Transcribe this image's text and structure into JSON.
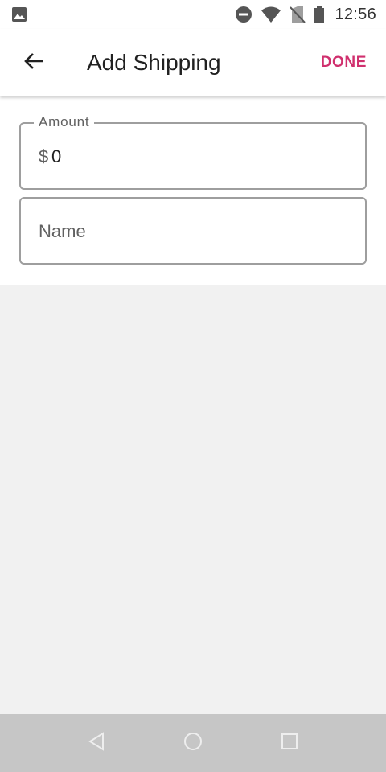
{
  "status_bar": {
    "time": "12:56",
    "icons": [
      "image-icon",
      "do-not-disturb-icon",
      "wifi-icon",
      "no-sim-icon",
      "battery-icon"
    ]
  },
  "app_bar": {
    "title": "Add Shipping",
    "done_label": "DONE",
    "back_icon": "arrow-back-icon"
  },
  "form": {
    "amount": {
      "label": "Amount",
      "prefix": "$",
      "value": "0"
    },
    "name": {
      "placeholder": "Name",
      "value": ""
    }
  },
  "nav_bar": {
    "icons": [
      "back-triangle-icon",
      "home-circle-icon",
      "recents-square-icon"
    ]
  },
  "colors": {
    "accent": "#d0306e",
    "field_border": "#9e9e9e",
    "background": "#f1f1f1",
    "nav_bar": "#c6c6c6"
  }
}
